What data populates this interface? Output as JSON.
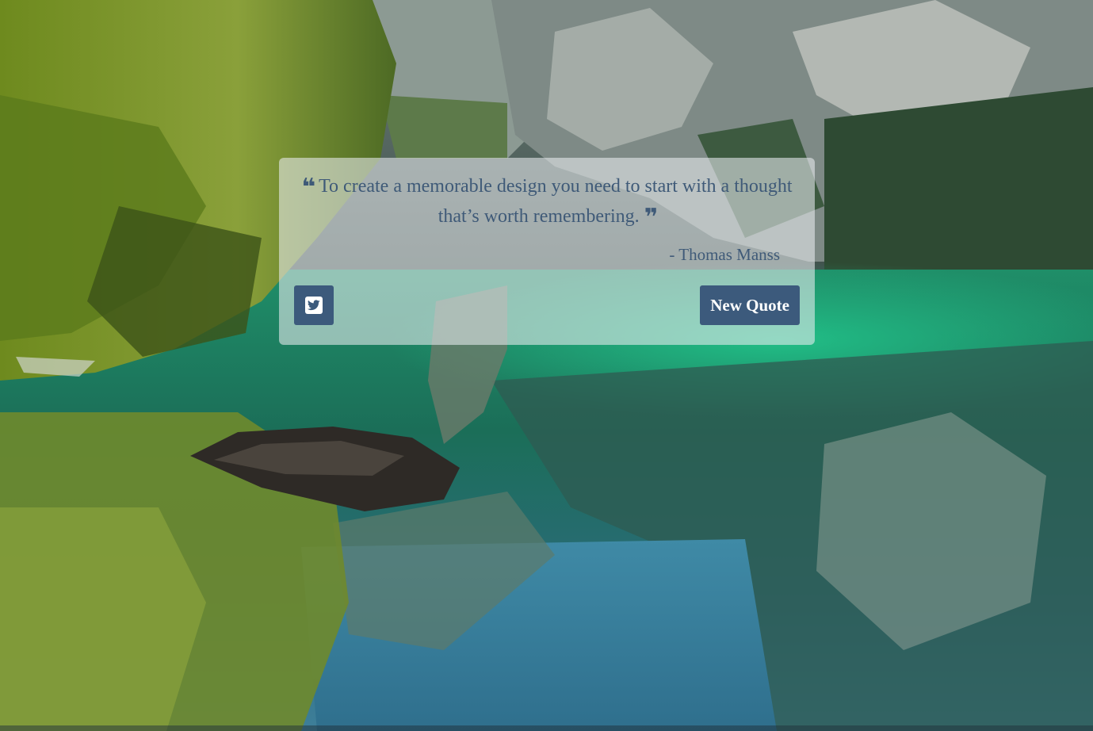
{
  "background": {
    "scene": "mountain-lake-landscape"
  },
  "quote": {
    "text": "To create a memorable design you need to start with a thought that’s worth remembering.",
    "author": "- Thomas Manss",
    "open_icon": "quote-left-icon",
    "close_icon": "quote-right-icon"
  },
  "actions": {
    "tweet_icon": "twitter-square-icon",
    "new_quote_label": "New Quote"
  },
  "colors": {
    "accent": "#3c5a7c",
    "text": "#3f5a78",
    "card": "rgba(232,236,240,0.58)"
  }
}
